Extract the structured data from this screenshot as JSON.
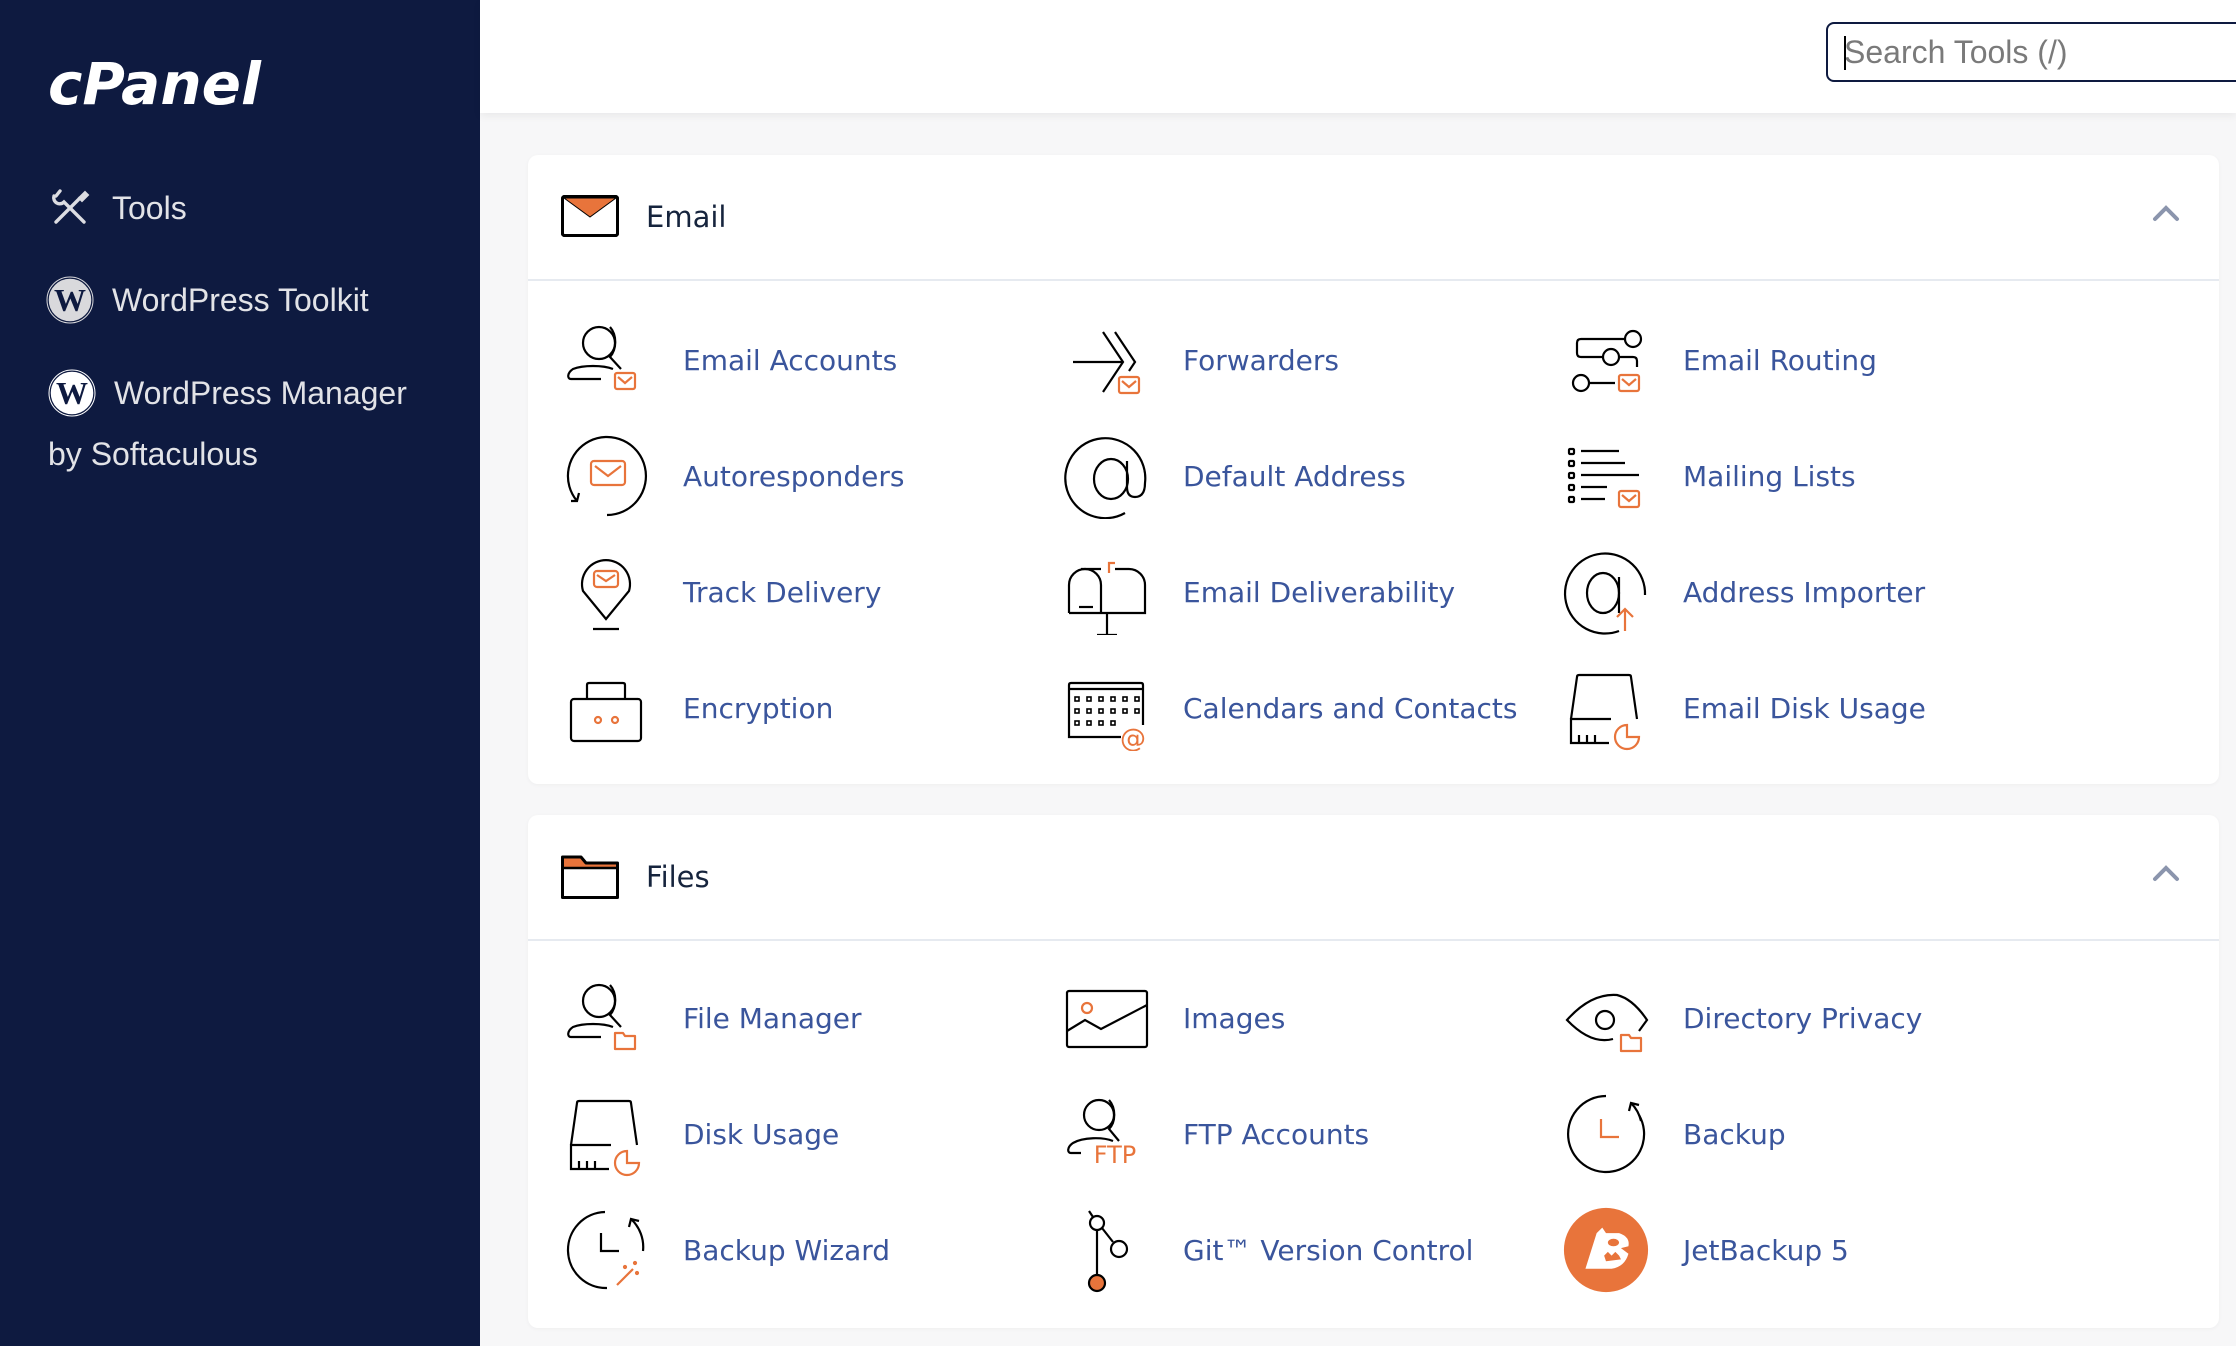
{
  "sidebar": {
    "logo": "cPanel",
    "items": [
      {
        "label": "Tools",
        "icon": "tools-icon"
      },
      {
        "label": "WordPress Toolkit",
        "icon": "wordpress-icon"
      },
      {
        "label": "WordPress Manager",
        "sublabel": "by Softaculous",
        "icon": "wordpress-icon"
      }
    ]
  },
  "search": {
    "placeholder": "Search Tools (/)",
    "value": ""
  },
  "colors": {
    "sidebar": "#0e1a40",
    "accent": "#e8743b",
    "link": "#3a559c",
    "heading": "#16243d"
  },
  "sections": [
    {
      "title": "Email",
      "icon": "envelope-icon",
      "expanded": true,
      "tools": [
        {
          "label": "Email Accounts",
          "icon": "email-accounts-icon"
        },
        {
          "label": "Forwarders",
          "icon": "forwarders-icon"
        },
        {
          "label": "Email Routing",
          "icon": "email-routing-icon"
        },
        {
          "label": "Autoresponders",
          "icon": "autoresponders-icon"
        },
        {
          "label": "Default Address",
          "icon": "at-sign-icon"
        },
        {
          "label": "Mailing Lists",
          "icon": "mailing-lists-icon"
        },
        {
          "label": "Track Delivery",
          "icon": "location-pin-icon"
        },
        {
          "label": "Email Deliverability",
          "icon": "mailbox-icon"
        },
        {
          "label": "Address Importer",
          "icon": "address-importer-icon"
        },
        {
          "label": "Encryption",
          "icon": "lock-icon"
        },
        {
          "label": "Calendars and Contacts",
          "icon": "calendar-icon"
        },
        {
          "label": "Email Disk Usage",
          "icon": "disk-usage-icon"
        }
      ]
    },
    {
      "title": "Files",
      "icon": "folder-icon",
      "expanded": true,
      "tools": [
        {
          "label": "File Manager",
          "icon": "file-manager-icon"
        },
        {
          "label": "Images",
          "icon": "image-icon"
        },
        {
          "label": "Directory Privacy",
          "icon": "eye-icon"
        },
        {
          "label": "Disk Usage",
          "icon": "disk-usage-icon"
        },
        {
          "label": "FTP Accounts",
          "icon": "ftp-accounts-icon"
        },
        {
          "label": "Backup",
          "icon": "backup-icon"
        },
        {
          "label": "Backup Wizard",
          "icon": "backup-wizard-icon"
        },
        {
          "label": "Git™ Version Control",
          "icon": "git-icon"
        },
        {
          "label": "JetBackup 5",
          "icon": "jetbackup-icon"
        }
      ]
    }
  ]
}
